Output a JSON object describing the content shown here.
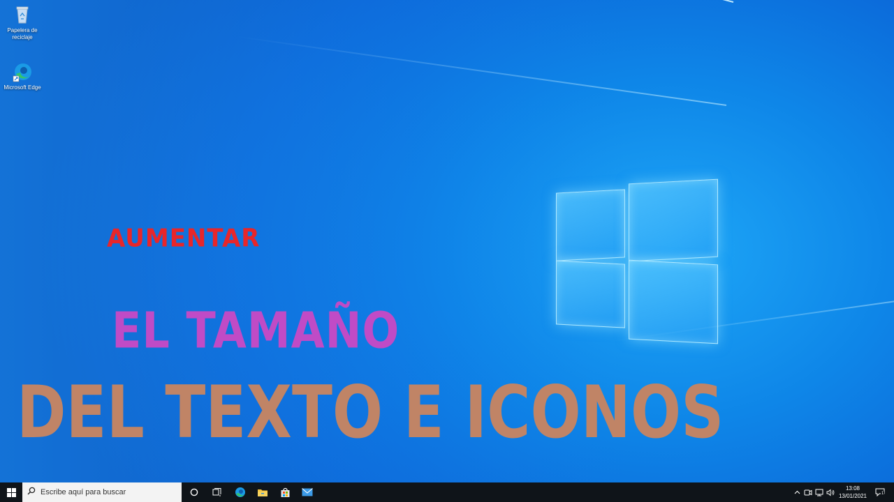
{
  "desktop": {
    "icons": [
      {
        "label": "Papelera de reciclaje",
        "icon": "recycle-bin-icon"
      },
      {
        "label": "Microsoft Edge",
        "icon": "edge-icon"
      }
    ],
    "overlay": {
      "line1": "AUMENTAR",
      "line2": "EL TAMAÑO",
      "line3": "DEL TEXTO E ICONOS",
      "colors": {
        "line1": "#e8262a",
        "line2": "#c04bc6",
        "line3": "#c08466"
      }
    }
  },
  "taskbar": {
    "search_placeholder": "Escribe aquí para buscar",
    "pinned": [
      "cortana-icon",
      "task-view-icon",
      "edge-icon",
      "file-explorer-icon",
      "store-icon",
      "mail-icon"
    ],
    "tray": [
      "chevron-up-icon",
      "meet-now-icon",
      "network-icon",
      "volume-icon"
    ],
    "time": "13:08",
    "date": "13/01/2021",
    "notification_count": "1",
    "colors": {
      "bar": "#0f1419",
      "search_bg": "#f3f3f3"
    }
  }
}
